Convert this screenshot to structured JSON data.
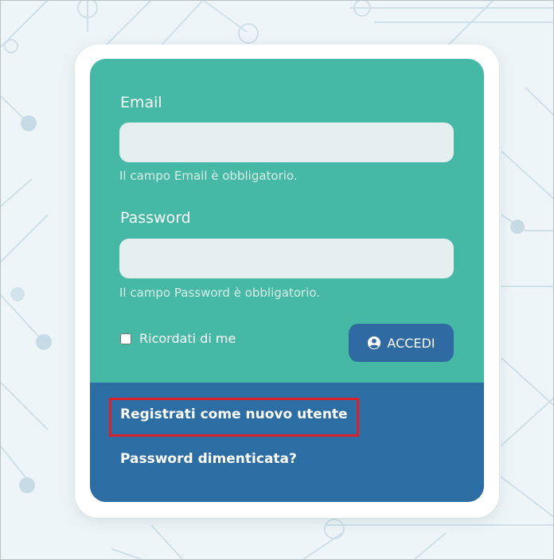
{
  "login_form": {
    "email_label": "Email",
    "email_value": "",
    "email_placeholder": "",
    "email_error": "Il campo Email è obbligatorio.",
    "password_label": "Password",
    "password_value": "",
    "password_placeholder": "",
    "password_error": "Il campo Password è obbligatorio.",
    "remember_label": "Ricordati di me",
    "login_button_label": "ACCEDI",
    "login_button_icon": "user-circle-icon"
  },
  "links": {
    "register_label": "Registrati come nuovo utente",
    "forgot_password_label": "Password dimenticata?"
  },
  "colors": {
    "form_bg": "#45b9a5",
    "links_bg": "#2c6da4",
    "button_bg": "#2f6aa2",
    "highlight": "#d9202b",
    "page_bg": "#eef5f8"
  }
}
